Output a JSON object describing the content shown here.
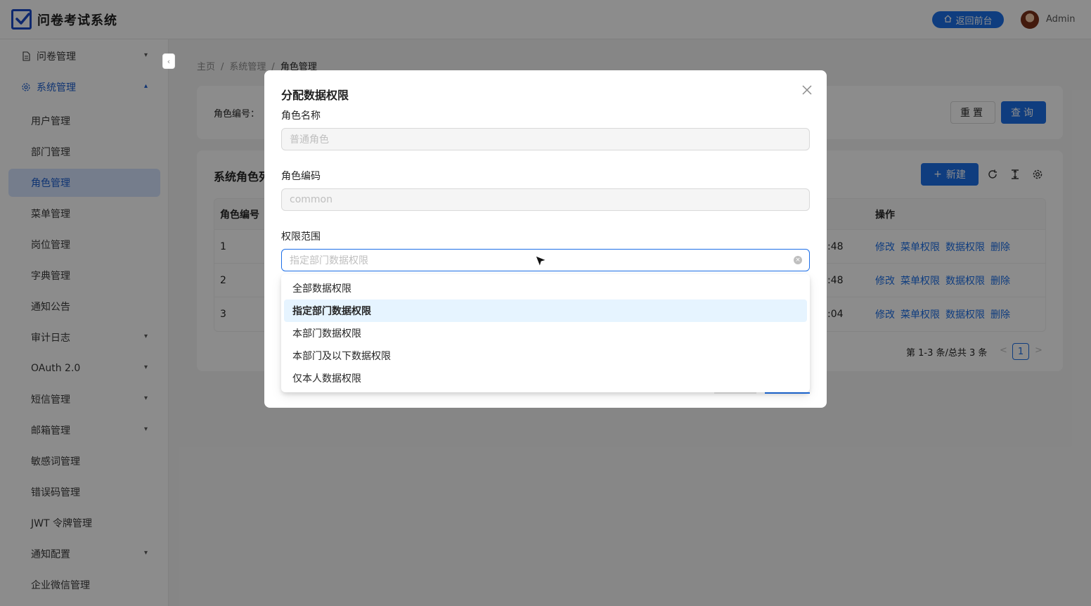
{
  "header": {
    "app_title": "问卷考试系统",
    "return_button": "返回前台",
    "user_name": "Admin"
  },
  "sidebar": {
    "items": [
      {
        "label": "问卷管理",
        "icon": "document-icon",
        "expandable": true
      },
      {
        "label": "系统管理",
        "icon": "gear-icon",
        "expandable": true,
        "expanded": true
      },
      {
        "label": "用户管理"
      },
      {
        "label": "部门管理"
      },
      {
        "label": "角色管理",
        "active": true
      },
      {
        "label": "菜单管理"
      },
      {
        "label": "岗位管理"
      },
      {
        "label": "字典管理"
      },
      {
        "label": "通知公告"
      },
      {
        "label": "审计日志",
        "expandable": true
      },
      {
        "label": "OAuth 2.0",
        "expandable": true
      },
      {
        "label": "短信管理",
        "expandable": true
      },
      {
        "label": "邮箱管理",
        "expandable": true
      },
      {
        "label": "敏感词管理"
      },
      {
        "label": "错误码管理"
      },
      {
        "label": "JWT 令牌管理"
      },
      {
        "label": "通知配置",
        "expandable": true
      },
      {
        "label": "企业微信管理"
      }
    ]
  },
  "breadcrumb": {
    "home": "主页",
    "parent": "系统管理",
    "current": "角色管理"
  },
  "search": {
    "role_code_label": "角色编号：",
    "reset_label": "重置",
    "query_label": "查询"
  },
  "table": {
    "title": "系统角色列",
    "new_button": "新建",
    "columns": {
      "code": "角色编号",
      "actions": "操作"
    },
    "rows": [
      {
        "code": "1",
        "time": ":48"
      },
      {
        "code": "2",
        "time": ":48"
      },
      {
        "code": "3",
        "time": ":04"
      }
    ],
    "actions": [
      "修改",
      "菜单权限",
      "数据权限",
      "删除"
    ],
    "pager": {
      "summary": "第 1-3 条/总共 3 条",
      "prev": "<",
      "page": "1",
      "next": ">"
    }
  },
  "modal": {
    "title": "分配数据权限",
    "role_name_label": "角色名称",
    "role_name_value": "普通角色",
    "role_code_label": "角色编码",
    "role_code_value": "common",
    "scope_label": "权限范围",
    "scope_placeholder": "指定部门数据权限",
    "options": [
      {
        "label": "全部数据权限"
      },
      {
        "label": "指定部门数据权限",
        "selected": true
      },
      {
        "label": "本部门数据权限"
      },
      {
        "label": "本部门及以下数据权限"
      },
      {
        "label": "仅本人数据权限"
      }
    ]
  },
  "colors": {
    "primary": "#1d6fe8",
    "brand": "#1a49c8",
    "active_menu_bg": "#d6e4ff",
    "selected_option_bg": "#e6f4ff"
  }
}
